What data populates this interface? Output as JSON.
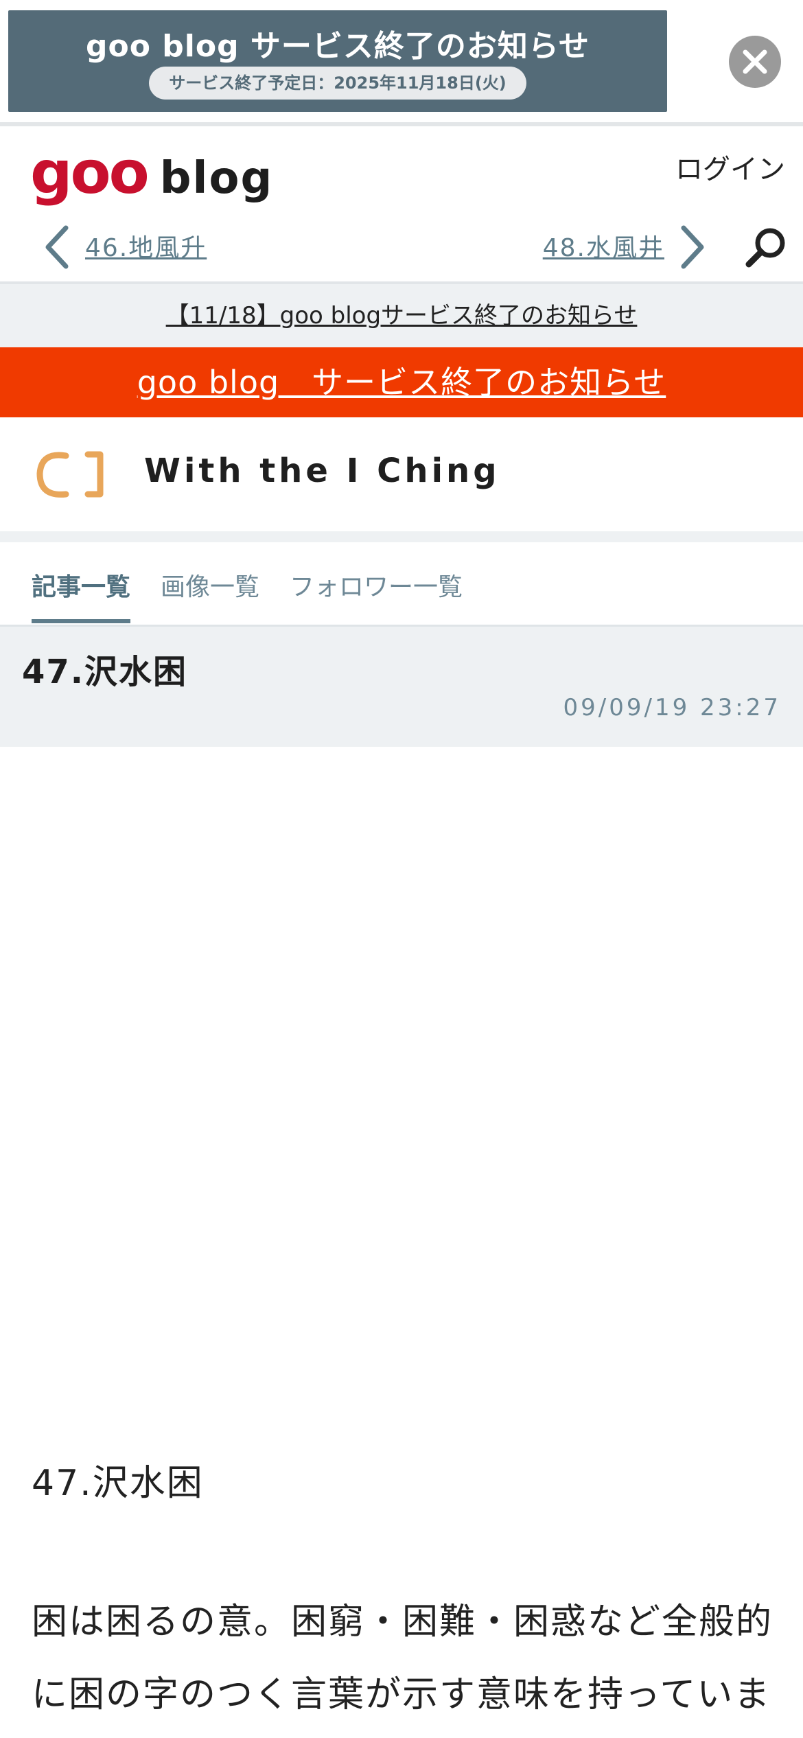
{
  "ad": {
    "title": "goo blog サービス終了のお知らせ",
    "subtitle": "サービス終了予定日：2025年11月18日(火)"
  },
  "header": {
    "logo_goo": "goo",
    "logo_blog": "blog",
    "login_label": "ログイン"
  },
  "nav": {
    "prev_label": "46.地風升",
    "next_label": "48.水風井"
  },
  "notice": {
    "link_text": "【11/18】goo blogサービス終了のお知らせ"
  },
  "red_banner": {
    "link_text": "goo blog　サービス終了のお知らせ"
  },
  "blog": {
    "title": "With the I Ching"
  },
  "tabs": [
    {
      "label": "記事一覧",
      "active": true
    },
    {
      "label": "画像一覧",
      "active": false
    },
    {
      "label": "フォロワー一覧",
      "active": false
    }
  ],
  "article": {
    "title": "47.沢水困",
    "date": "09/09/19 23:27",
    "heading": "47.沢水困",
    "body": "困は困るの意。困窮・困難・困惑など全般的に困の字のつく言葉が示す意味を持っていま"
  },
  "colors": {
    "ad_bg": "#546b78",
    "brand_red": "#c8102e",
    "banner_red": "#f03a00",
    "accent": "#5e7c8a"
  }
}
